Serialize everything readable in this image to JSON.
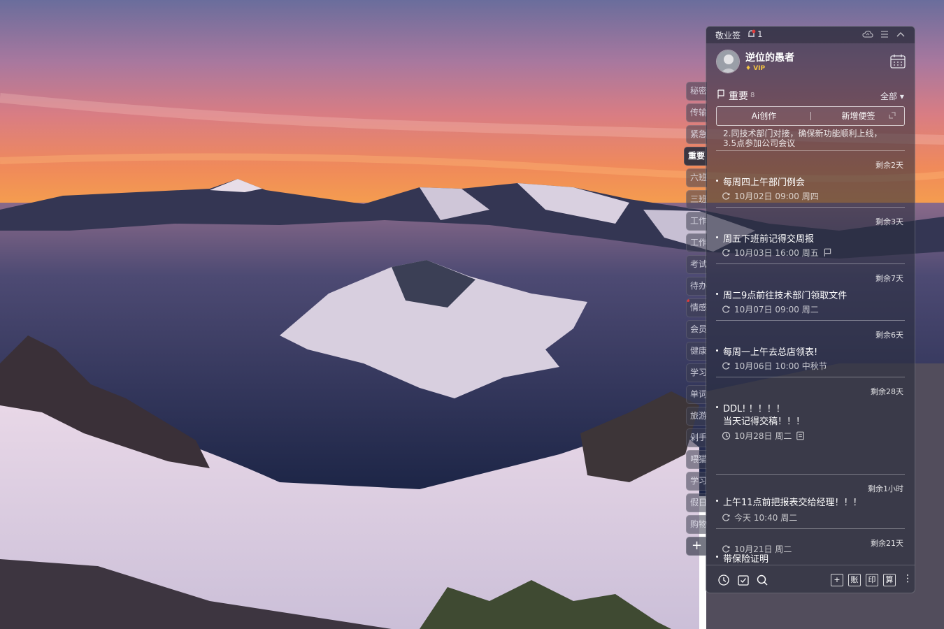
{
  "app": {
    "title": "敬业签",
    "notification_count": "1",
    "icons": [
      "bell-icon",
      "cloud-sync-icon",
      "menu-icon",
      "collapse-up-icon"
    ]
  },
  "user": {
    "name": "逆位的愚者",
    "vip_label": "VIP"
  },
  "side_tabs": [
    {
      "label": "秘密"
    },
    {
      "label": "传输"
    },
    {
      "label": "紧急"
    },
    {
      "label": "重要",
      "active": true
    },
    {
      "label": "六班"
    },
    {
      "label": "三班"
    },
    {
      "label": "工作"
    },
    {
      "label": "工作"
    },
    {
      "label": "考试"
    },
    {
      "label": "待办"
    },
    {
      "label": "情感",
      "marked": true
    },
    {
      "label": "会员"
    },
    {
      "label": "健康"
    },
    {
      "label": "学习"
    },
    {
      "label": "单词"
    },
    {
      "label": "旅游"
    },
    {
      "label": "剁手"
    },
    {
      "label": "喂猫"
    },
    {
      "label": "学习"
    },
    {
      "label": "假日"
    },
    {
      "label": "购物"
    }
  ],
  "side_add_label": "+",
  "section": {
    "title": "重要",
    "count": "8",
    "filter": "全部 ▾"
  },
  "actions": {
    "ai_label": "Ai创作",
    "new_note_label": "新增便签"
  },
  "partial_note": {
    "line1": "2.同技术部门对接，确保新功能顺利上线，",
    "line2": "3.5点参加公司会议"
  },
  "notes": [
    {
      "remaining": "剩余2天",
      "lines": [
        "每周四上午部门例会"
      ],
      "meta": "10月02日 09:00 周四",
      "meta_icon": "repeat-icon"
    },
    {
      "remaining": "剩余3天",
      "lines": [
        "周五下班前记得交周报"
      ],
      "meta": "10月03日 16:00 周五",
      "meta_icon": "repeat-icon",
      "trail_icon": "flag-icon"
    },
    {
      "remaining": "剩余7天",
      "lines": [
        "周二9点前往技术部门领取文件"
      ],
      "meta": "10月07日 09:00 周二",
      "meta_icon": "repeat-icon"
    },
    {
      "remaining": "剩余6天",
      "lines": [
        "每周一上午去总店领表!"
      ],
      "meta": "10月06日 10:00 中秋节",
      "meta_icon": "repeat-icon"
    },
    {
      "remaining": "剩余28天",
      "lines": [
        "DDL! ！！！！",
        "当天记得交稿！！！"
      ],
      "meta": "10月28日 周二",
      "meta_icon": "clock-icon",
      "trail_icon": "note-icon"
    },
    {
      "remaining": "剩余1小时",
      "lines": [
        "上午11点前把报表交给经理！！！"
      ],
      "meta": "今天 10:40 周二",
      "meta_icon": "repeat-icon"
    },
    {
      "remaining": "剩余21天",
      "lines": [
        "带保险证明"
      ],
      "meta": "10月21日 周二",
      "meta_icon": "repeat-icon"
    }
  ],
  "bottom_bar": {
    "left_icons": [
      "history-icon",
      "checklist-icon",
      "search-icon"
    ],
    "add_label": "+",
    "ledger_label": "账",
    "print_label": "印",
    "calc_label": "算",
    "more_label": "⋮"
  }
}
